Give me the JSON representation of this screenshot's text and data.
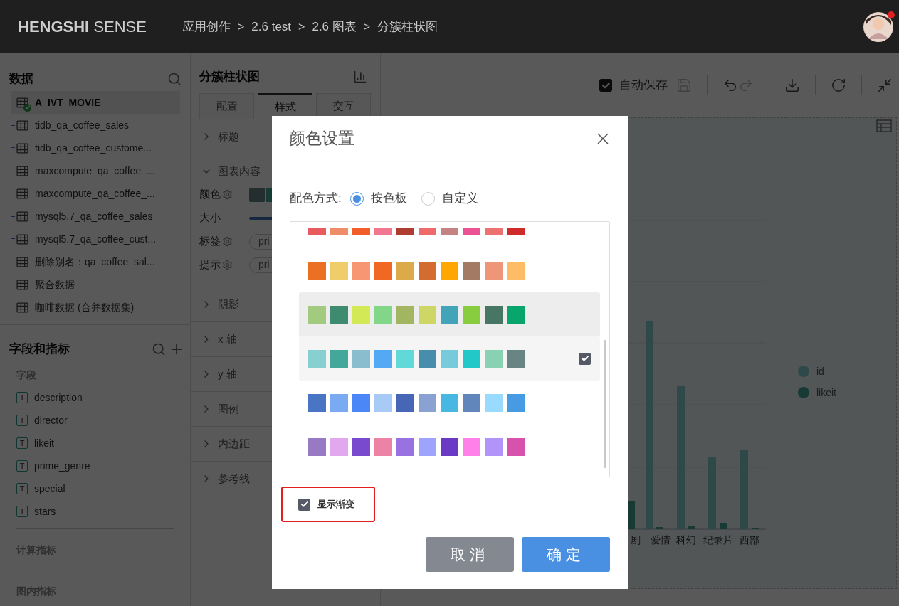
{
  "header": {
    "logo_bold": "HENGSHI",
    "logo_light": "SENSE",
    "breadcrumbs": [
      {
        "label": "应用创作"
      },
      {
        "separator": ">",
        "label": "2.6 test"
      },
      {
        "separator": ">",
        "label": "2.6 图表"
      },
      {
        "separator": ">",
        "label": "分簇柱状图"
      }
    ],
    "notification": true
  },
  "sidebar": {
    "data_title": "数据",
    "datasets": [
      {
        "kind": "single",
        "items": [
          {
            "name": "A_IVT_MOVIE",
            "selected": true,
            "connected": true
          }
        ]
      },
      {
        "kind": "linked",
        "items": [
          {
            "name": "tidb_qa_coffee_sales",
            "selected": false,
            "connected": false
          },
          {
            "name": "tidb_qa_coffee_custome...",
            "selected": false,
            "connected": false
          }
        ]
      },
      {
        "kind": "linked",
        "items": [
          {
            "name": "maxcompute_qa_coffee_...",
            "selected": false,
            "connected": false
          },
          {
            "name": "maxcompute_qa_coffee_...",
            "selected": false,
            "connected": false
          }
        ]
      },
      {
        "kind": "linked",
        "items": [
          {
            "name": "mysql5.7_qa_coffee_sales",
            "selected": false,
            "connected": false
          },
          {
            "name": "mysql5.7_qa_coffee_cust...",
            "selected": false,
            "connected": false
          }
        ]
      },
      {
        "kind": "single",
        "items": [
          {
            "name": "删除别名：qa_coffee_sal...",
            "selected": false,
            "connected": false
          }
        ]
      },
      {
        "kind": "single",
        "items": [
          {
            "name": "聚合数据",
            "selected": false,
            "connected": false
          }
        ]
      },
      {
        "kind": "single",
        "items": [
          {
            "name": "咖啡数据 (合并数据集)",
            "selected": false,
            "connected": false
          }
        ]
      }
    ],
    "fields_title": "字段和指标",
    "fields_subtitle": "字段",
    "fields": [
      {
        "type": "T",
        "name": "description"
      },
      {
        "type": "T",
        "name": "director"
      },
      {
        "type": "T",
        "name": "likeit"
      },
      {
        "type": "T",
        "name": "prime_genre"
      },
      {
        "type": "T",
        "name": "special"
      },
      {
        "type": "T",
        "name": "stars"
      }
    ],
    "groups": [
      "计算指标",
      "图内指标"
    ]
  },
  "panel": {
    "title": "分簇柱状图",
    "tabs": [
      {
        "label": "配置",
        "selected": false
      },
      {
        "label": "样式",
        "selected": true
      },
      {
        "label": "交互",
        "selected": false
      }
    ],
    "sections": [
      {
        "label": "标题",
        "expanded": false
      },
      {
        "label": "图表内容",
        "expanded": true,
        "rows": [
          {
            "kind": "swatches",
            "label": "颜色",
            "settings": true
          },
          {
            "kind": "bar",
            "label": "大小",
            "settings": false
          },
          {
            "kind": "pill",
            "label": "标签",
            "settings": true,
            "value": "pri"
          },
          {
            "kind": "pill",
            "label": "提示",
            "settings": true,
            "value": "pri"
          }
        ]
      },
      {
        "label": "阴影",
        "expanded": false
      },
      {
        "label": "x 轴",
        "expanded": false
      },
      {
        "label": "y 轴",
        "expanded": false
      },
      {
        "label": "图例",
        "expanded": false
      },
      {
        "label": "内边距",
        "expanded": false
      },
      {
        "label": "参考线",
        "expanded": false
      }
    ]
  },
  "toolbar": {
    "autosave": {
      "label": "自动保存",
      "checked": true
    },
    "buttons": [
      {
        "kind": "save",
        "disabled": true
      },
      {
        "kind": "undo",
        "disabled": false
      },
      {
        "kind": "redo",
        "disabled": true
      },
      {
        "kind": "download",
        "disabled": false
      },
      {
        "kind": "refresh",
        "disabled": false
      },
      {
        "kind": "collapse",
        "disabled": false
      }
    ]
  },
  "chart": {
    "categories": [
      "剧",
      "爱情",
      "科幻",
      "纪录片",
      "西部"
    ],
    "legend": [
      {
        "label": "id"
      },
      {
        "label": "likeit"
      }
    ]
  },
  "dialog": {
    "title": "颜色设置",
    "mode_label": "配色方式:",
    "modes": [
      {
        "label": "按色板",
        "selected": true
      },
      {
        "label": "自定义",
        "selected": false
      }
    ],
    "palettes": [
      {
        "selected": false,
        "hovered": false,
        "swatches": [
          {
            "color": "#e95a5e"
          },
          {
            "color": "#ef8c6a"
          },
          {
            "color": "#f25e2a"
          },
          {
            "color": "#f27690"
          },
          {
            "color": "#ae3c31"
          },
          {
            "color": "#ef6a6a"
          },
          {
            "color": "#c48282"
          },
          {
            "color": "#ec5394"
          },
          {
            "color": "#ec7272"
          },
          {
            "color": "#cf2b2b"
          }
        ]
      },
      {
        "selected": false,
        "hovered": false,
        "swatches": [
          {
            "color": "#eb7024"
          },
          {
            "color": "#f0cc6a"
          },
          {
            "color": "#f69672"
          },
          {
            "color": "#f06822"
          },
          {
            "color": "#dcaa48"
          },
          {
            "color": "#d26c30"
          },
          {
            "color": "#ffa600"
          },
          {
            "color": "#a37b65"
          },
          {
            "color": "#ee9677"
          },
          {
            "color": "#ffbc66"
          }
        ]
      },
      {
        "selected": false,
        "hovered": true,
        "swatches": [
          {
            "color": "#a3cb80"
          },
          {
            "color": "#3e8b6f"
          },
          {
            "color": "#d4e956"
          },
          {
            "color": "#82d688"
          },
          {
            "color": "#a2b661"
          },
          {
            "color": "#ced766"
          },
          {
            "color": "#42a3b9"
          },
          {
            "color": "#88cc40"
          },
          {
            "color": "#477764"
          },
          {
            "color": "#08a66c"
          }
        ]
      },
      {
        "selected": true,
        "hovered": false,
        "swatches": [
          {
            "color": "#88cfd1"
          },
          {
            "color": "#43a799"
          },
          {
            "color": "#8abdce"
          },
          {
            "color": "#53a9f3"
          },
          {
            "color": "#61d9d9"
          },
          {
            "color": "#488dab"
          },
          {
            "color": "#77cad9"
          },
          {
            "color": "#22c8c8"
          },
          {
            "color": "#88d1b2"
          },
          {
            "color": "#688483"
          }
        ]
      },
      {
        "selected": false,
        "hovered": false,
        "swatches": [
          {
            "color": "#4a74c4"
          },
          {
            "color": "#7aaaf1"
          },
          {
            "color": "#4b87f6"
          },
          {
            "color": "#a7cbf6"
          },
          {
            "color": "#4866b6"
          },
          {
            "color": "#8aa2d1"
          },
          {
            "color": "#48b8e2"
          },
          {
            "color": "#6086bc"
          },
          {
            "color": "#99daff"
          },
          {
            "color": "#469be2"
          }
        ]
      },
      {
        "selected": false,
        "hovered": false,
        "swatches": [
          {
            "color": "#9879c4"
          },
          {
            "color": "#e1a8ef"
          },
          {
            "color": "#7a4ace"
          },
          {
            "color": "#ec82a6"
          },
          {
            "color": "#9972e2"
          },
          {
            "color": "#9ea4fc"
          },
          {
            "color": "#6a3ac6"
          },
          {
            "color": "#ff80e8"
          },
          {
            "color": "#b193fa"
          },
          {
            "color": "#d652ac"
          }
        ]
      }
    ],
    "gradient": {
      "label": "显示渐变",
      "checked": true,
      "highlighted": true
    },
    "buttons": [
      {
        "kind": "cancel",
        "label": "取消"
      },
      {
        "kind": "confirm",
        "label": "确定"
      }
    ]
  }
}
